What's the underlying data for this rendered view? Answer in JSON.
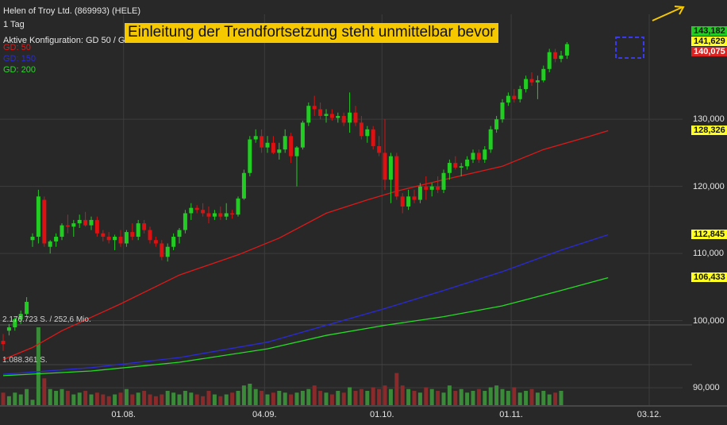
{
  "header": {
    "title": "Helen of Troy Ltd. (869993) (HELE)",
    "interval": "1 Tag",
    "config": "Aktive Konfiguration: GD 50 / GD 100 / GD 200",
    "legend": [
      {
        "label": "GD: 50",
        "color": "#e01818"
      },
      {
        "label": "GD: 150",
        "color": "#2a2ad8"
      },
      {
        "label": "GD: 200",
        "color": "#22dd22"
      }
    ]
  },
  "banner": "Einleitung der Trendfortsetzung steht unmittelbar bevor",
  "volume_labels": [
    "2.176.723 S. / 252,6 Mio.",
    "1.088.361 S."
  ],
  "price_boxes": [
    {
      "label": "143,182",
      "value": 143.182,
      "bg": "#22cc22"
    },
    {
      "label": "141,629",
      "value": 141.629,
      "bg": "#ffff22"
    },
    {
      "label": "140,075",
      "value": 140.075,
      "bg": "#dd2222"
    },
    {
      "label": "128,326",
      "value": 128.326,
      "bg": "#ffff22"
    },
    {
      "label": "112,845",
      "value": 112.845,
      "bg": "#ffff22"
    },
    {
      "label": "106,433",
      "value": 106.433,
      "bg": "#ffff22"
    }
  ],
  "colors": {
    "background": "#282828",
    "grid": "#3c3c3c",
    "up": "#22cc22",
    "down": "#dd1111",
    "banner": "#f5c800",
    "arrow": "#f5c800"
  },
  "chart_data": {
    "type": "candlestick",
    "ylim": [
      88,
      146
    ],
    "yticks": [
      {
        "label": "90,000",
        "value": 90
      },
      {
        "label": "100,000",
        "value": 100
      },
      {
        "label": "110,000",
        "value": 110
      },
      {
        "label": "120,000",
        "value": 120
      },
      {
        "label": "130,000",
        "value": 130
      }
    ],
    "xticks": [
      {
        "label": "01.08.",
        "index": 20.5
      },
      {
        "label": "04.09.",
        "index": 44.5
      },
      {
        "label": "01.10.",
        "index": 64.5
      },
      {
        "label": "01.11.",
        "index": 86.5
      },
      {
        "label": "03.12.",
        "index": 110
      }
    ],
    "x_count": 116,
    "candles": [
      [
        97.0,
        98.0,
        95.5,
        96.5
      ],
      [
        98.5,
        99.5,
        97.8,
        99.0
      ],
      [
        99.0,
        100.5,
        98.5,
        100.2
      ],
      [
        100.2,
        101.5,
        99.5,
        101.0
      ],
      [
        101.0,
        103.5,
        100.5,
        102.8
      ],
      [
        112.0,
        113.0,
        111.0,
        112.5
      ],
      [
        112.5,
        119.5,
        111.5,
        118.5
      ],
      [
        118.0,
        118.5,
        111.0,
        111.5
      ],
      [
        111.0,
        112.0,
        110.0,
        111.8
      ],
      [
        111.8,
        113.0,
        111.0,
        112.5
      ],
      [
        112.5,
        114.5,
        112.0,
        114.2
      ],
      [
        114.2,
        115.8,
        113.0,
        114.0
      ],
      [
        114.0,
        115.0,
        112.5,
        114.5
      ],
      [
        114.5,
        115.8,
        113.8,
        115.0
      ],
      [
        115.0,
        116.2,
        114.0,
        114.2
      ],
      [
        114.2,
        115.5,
        113.5,
        115.0
      ],
      [
        115.0,
        115.5,
        112.5,
        113.0
      ],
      [
        113.0,
        113.5,
        111.8,
        112.5
      ],
      [
        112.5,
        113.2,
        111.5,
        112.0
      ],
      [
        112.0,
        112.8,
        110.5,
        112.5
      ],
      [
        112.5,
        113.5,
        111.0,
        111.5
      ],
      [
        111.5,
        113.5,
        111.0,
        113.2
      ],
      [
        113.2,
        114.5,
        112.0,
        112.5
      ],
      [
        112.5,
        115.0,
        112.0,
        114.5
      ],
      [
        114.5,
        115.0,
        113.0,
        113.5
      ],
      [
        113.5,
        114.0,
        111.5,
        112.0
      ],
      [
        112.0,
        112.5,
        111.0,
        111.5
      ],
      [
        111.5,
        112.0,
        109.0,
        109.5
      ],
      [
        109.5,
        111.5,
        108.8,
        111.0
      ],
      [
        111.0,
        113.0,
        110.5,
        112.5
      ],
      [
        112.5,
        113.8,
        111.5,
        113.5
      ],
      [
        113.5,
        116.5,
        113.0,
        116.0
      ],
      [
        116.0,
        117.5,
        115.0,
        116.8
      ],
      [
        116.8,
        117.2,
        116.0,
        116.5
      ],
      [
        116.5,
        117.5,
        115.5,
        116.0
      ],
      [
        116.0,
        117.0,
        114.5,
        115.5
      ],
      [
        115.5,
        116.5,
        115.0,
        116.0
      ],
      [
        116.0,
        117.0,
        115.0,
        115.5
      ],
      [
        115.5,
        117.5,
        115.0,
        116.0
      ],
      [
        116.0,
        116.5,
        115.2,
        115.8
      ],
      [
        115.8,
        118.5,
        115.5,
        118.2
      ],
      [
        118.2,
        122.5,
        118.0,
        122.0
      ],
      [
        122.0,
        127.5,
        121.5,
        127.0
      ],
      [
        127.0,
        128.5,
        126.5,
        127.5
      ],
      [
        127.5,
        128.5,
        125.0,
        125.8
      ],
      [
        125.8,
        127.5,
        125.0,
        126.5
      ],
      [
        126.5,
        127.5,
        124.8,
        125.0
      ],
      [
        125.0,
        126.5,
        124.0,
        125.5
      ],
      [
        125.5,
        128.5,
        125.0,
        127.5
      ],
      [
        127.5,
        128.0,
        123.5,
        124.5
      ],
      [
        124.5,
        126.0,
        120.0,
        125.8
      ],
      [
        125.8,
        129.8,
        125.5,
        129.5
      ],
      [
        129.5,
        132.5,
        129.0,
        132.0
      ],
      [
        132.0,
        133.5,
        130.5,
        131.5
      ],
      [
        131.5,
        132.5,
        130.0,
        130.5
      ],
      [
        130.5,
        131.5,
        129.5,
        130.8
      ],
      [
        130.8,
        131.5,
        129.8,
        130.2
      ],
      [
        130.2,
        131.0,
        129.5,
        130.5
      ],
      [
        130.5,
        131.0,
        129.0,
        129.5
      ],
      [
        129.5,
        134.0,
        128.0,
        131.0
      ],
      [
        131.0,
        132.0,
        129.0,
        129.5
      ],
      [
        129.5,
        130.5,
        127.0,
        127.5
      ],
      [
        127.5,
        129.0,
        126.5,
        128.5
      ],
      [
        128.5,
        129.0,
        125.5,
        126.0
      ],
      [
        126.0,
        127.5,
        124.5,
        125.0
      ],
      [
        125.0,
        130.0,
        119.5,
        121.0
      ],
      [
        121.0,
        125.0,
        117.5,
        124.5
      ],
      [
        124.5,
        125.0,
        118.0,
        118.5
      ],
      [
        118.5,
        119.0,
        116.0,
        117.0
      ],
      [
        117.0,
        119.5,
        116.5,
        118.5
      ],
      [
        118.5,
        119.5,
        117.5,
        118.0
      ],
      [
        118.0,
        120.5,
        117.5,
        120.0
      ],
      [
        120.0,
        121.5,
        118.0,
        119.5
      ],
      [
        119.5,
        120.5,
        118.5,
        120.0
      ],
      [
        120.0,
        121.5,
        119.0,
        119.5
      ],
      [
        119.5,
        122.5,
        119.0,
        122.0
      ],
      [
        122.0,
        124.0,
        121.0,
        123.5
      ],
      [
        123.5,
        124.5,
        122.5,
        122.8
      ],
      [
        122.8,
        123.5,
        121.5,
        123.0
      ],
      [
        123.0,
        124.5,
        122.5,
        124.0
      ],
      [
        124.0,
        125.5,
        123.5,
        125.0
      ],
      [
        125.0,
        125.5,
        123.5,
        124.0
      ],
      [
        124.0,
        126.0,
        123.5,
        125.5
      ],
      [
        125.5,
        129.0,
        125.0,
        128.5
      ],
      [
        128.5,
        130.5,
        128.0,
        130.0
      ],
      [
        130.0,
        133.0,
        129.5,
        132.5
      ],
      [
        132.5,
        134.0,
        132.0,
        133.5
      ],
      [
        133.5,
        134.5,
        132.5,
        133.0
      ],
      [
        133.0,
        135.0,
        132.5,
        134.5
      ],
      [
        134.5,
        136.5,
        134.0,
        136.0
      ],
      [
        136.0,
        137.0,
        135.0,
        135.5
      ],
      [
        135.5,
        136.5,
        133.0,
        135.8
      ],
      [
        135.8,
        138.0,
        135.5,
        137.5
      ],
      [
        137.5,
        140.5,
        137.0,
        140.0
      ],
      [
        140.0,
        140.5,
        138.5,
        139.0
      ],
      [
        139.0,
        140.2,
        138.5,
        139.5
      ],
      [
        139.5,
        141.5,
        139.0,
        141.2
      ]
    ],
    "volumes": [
      0.35,
      0.25,
      0.35,
      0.3,
      0.45,
      0.15,
      2.18,
      0.75,
      0.45,
      0.4,
      0.45,
      0.4,
      0.3,
      0.35,
      0.4,
      0.3,
      0.35,
      0.3,
      0.25,
      0.3,
      0.35,
      0.45,
      0.3,
      0.35,
      0.4,
      0.3,
      0.25,
      0.3,
      0.4,
      0.35,
      0.3,
      0.4,
      0.35,
      0.3,
      0.25,
      0.4,
      0.3,
      0.25,
      0.3,
      0.35,
      0.4,
      0.55,
      0.6,
      0.45,
      0.4,
      0.3,
      0.35,
      0.4,
      0.35,
      0.3,
      0.35,
      0.4,
      0.45,
      0.55,
      0.4,
      0.35,
      0.3,
      0.4,
      0.35,
      0.5,
      0.4,
      0.45,
      0.4,
      0.5,
      0.45,
      0.55,
      0.45,
      0.9,
      0.55,
      0.45,
      0.4,
      0.35,
      0.5,
      0.45,
      0.4,
      0.35,
      0.55,
      0.4,
      0.45,
      0.35,
      0.4,
      0.45,
      0.4,
      0.5,
      0.55,
      0.45,
      0.4,
      0.5,
      0.35,
      0.4,
      0.45,
      0.35,
      0.4,
      0.3,
      0.35,
      0.4
    ],
    "volume_ylim": [
      0,
      2.18
    ],
    "series": [
      {
        "name": "GD: 50",
        "color": "#e01818",
        "points": [
          [
            0,
            94.2
          ],
          [
            5,
            96.0
          ],
          [
            10,
            98.5
          ],
          [
            20,
            102.5
          ],
          [
            30,
            106.8
          ],
          [
            40,
            109.8
          ],
          [
            47,
            112.3
          ],
          [
            55,
            116.0
          ],
          [
            62,
            118.0
          ],
          [
            67,
            119.3
          ],
          [
            75,
            121.0
          ],
          [
            85,
            123.0
          ],
          [
            92,
            125.5
          ],
          [
            100,
            127.5
          ],
          [
            103,
            128.3
          ]
        ]
      },
      {
        "name": "GD: 150",
        "color": "#2a2ad8",
        "points": [
          [
            0,
            92.0
          ],
          [
            15,
            93.0
          ],
          [
            30,
            94.5
          ],
          [
            45,
            96.8
          ],
          [
            55,
            99.3
          ],
          [
            65,
            101.8
          ],
          [
            75,
            104.5
          ],
          [
            85,
            107.3
          ],
          [
            95,
            110.5
          ],
          [
            103,
            112.8
          ]
        ]
      },
      {
        "name": "GD: 200",
        "color": "#22dd22",
        "points": [
          [
            0,
            91.8
          ],
          [
            15,
            92.5
          ],
          [
            30,
            93.8
          ],
          [
            45,
            95.8
          ],
          [
            55,
            97.8
          ],
          [
            65,
            99.3
          ],
          [
            75,
            100.6
          ],
          [
            85,
            102.2
          ],
          [
            95,
            104.5
          ],
          [
            103,
            106.4
          ]
        ]
      }
    ]
  }
}
